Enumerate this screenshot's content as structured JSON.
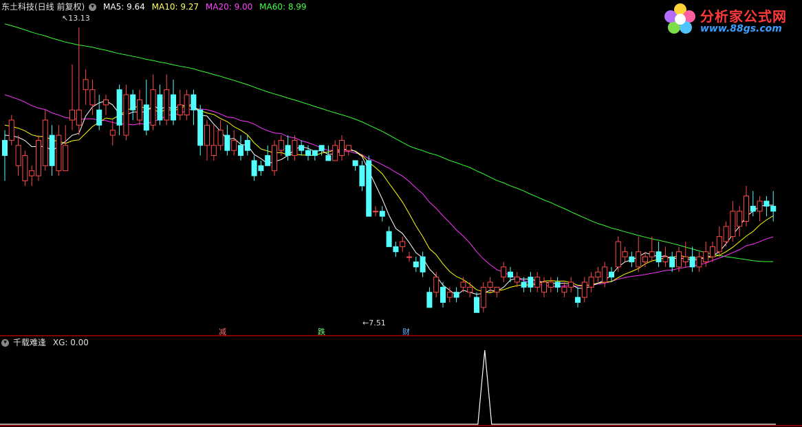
{
  "header": {
    "stock_name": "东土科技(日线 前复权)",
    "ma5": "MA5: 9.64",
    "ma10": "MA10: 9.27",
    "ma20": "MA20: 9.00",
    "ma60": "MA60: 8.99",
    "colors": {
      "ma5": "#ffffff",
      "ma10": "#ffff00",
      "ma20": "#ff33ff",
      "ma60": "#33ff33"
    }
  },
  "logo": {
    "title": "分析家公式网",
    "url": "www.88gs.com"
  },
  "annotations": {
    "high": "13.13",
    "low": "7.51",
    "markers": [
      "减",
      "跌",
      "财"
    ]
  },
  "indicator": {
    "name": "千载难逢",
    "xg": "XG: 0.00"
  },
  "chart_data": {
    "type": "candlestick",
    "ylim": [
      7.3,
      13.4
    ],
    "candles": [
      [
        10.9,
        10.6,
        11.1,
        10.1
      ],
      [
        10.9,
        11.3,
        11.4,
        10.8
      ],
      [
        10.4,
        10.8,
        11.0,
        10.2
      ],
      [
        10.1,
        10.6,
        10.7,
        10.0
      ],
      [
        10.2,
        10.3,
        10.4,
        10.0
      ],
      [
        10.2,
        10.9,
        11.0,
        10.1
      ],
      [
        10.4,
        11.3,
        11.5,
        10.3
      ],
      [
        11.0,
        10.4,
        11.2,
        10.2
      ],
      [
        10.3,
        11.0,
        11.2,
        10.2
      ],
      [
        10.3,
        10.8,
        11.2,
        10.3
      ],
      [
        11.3,
        11.5,
        12.4,
        11.1
      ],
      [
        11.2,
        11.5,
        13.13,
        11.0
      ],
      [
        11.9,
        12.1,
        12.3,
        11.6
      ],
      [
        11.6,
        11.9,
        12.1,
        11.4
      ],
      [
        11.5,
        11.2,
        11.8,
        11.1
      ],
      [
        11.6,
        11.7,
        11.8,
        11.4
      ],
      [
        11.0,
        11.1,
        11.3,
        10.8
      ],
      [
        11.9,
        11.2,
        12.0,
        11.0
      ],
      [
        11.0,
        11.8,
        12.0,
        10.9
      ],
      [
        11.8,
        11.5,
        11.9,
        11.3
      ],
      [
        11.3,
        11.7,
        11.9,
        11.2
      ],
      [
        11.6,
        11.1,
        12.1,
        11.0
      ],
      [
        11.2,
        11.9,
        12.2,
        11.1
      ],
      [
        11.8,
        11.3,
        12.0,
        11.2
      ],
      [
        11.3,
        11.9,
        12.2,
        11.2
      ],
      [
        11.8,
        11.3,
        12.1,
        11.2
      ],
      [
        11.4,
        11.6,
        11.9,
        11.3
      ],
      [
        11.4,
        11.8,
        11.9,
        11.3
      ],
      [
        11.8,
        11.5,
        11.9,
        11.2
      ],
      [
        11.5,
        10.8,
        11.6,
        10.6
      ],
      [
        10.8,
        11.2,
        11.3,
        10.5
      ],
      [
        10.6,
        10.8,
        11.2,
        10.5
      ],
      [
        10.8,
        11.1,
        11.3,
        10.7
      ],
      [
        11.0,
        10.7,
        11.2,
        10.6
      ],
      [
        10.7,
        10.9,
        11.1,
        10.6
      ],
      [
        10.8,
        10.6,
        11.0,
        10.5
      ],
      [
        10.9,
        10.7,
        11.0,
        10.6
      ],
      [
        10.5,
        10.2,
        10.6,
        10.1
      ],
      [
        10.4,
        10.3,
        10.5,
        10.2
      ],
      [
        10.6,
        10.4,
        10.8,
        10.4
      ],
      [
        10.3,
        10.8,
        10.9,
        10.2
      ],
      [
        10.7,
        10.9,
        11.0,
        10.6
      ],
      [
        10.8,
        10.6,
        11.0,
        10.5
      ],
      [
        10.6,
        10.9,
        11.0,
        10.5
      ],
      [
        10.8,
        10.7,
        10.9,
        10.6
      ],
      [
        10.7,
        10.6,
        10.8,
        10.5
      ],
      [
        10.7,
        10.6,
        10.7,
        10.5
      ],
      [
        10.8,
        10.7,
        10.8,
        10.6
      ],
      [
        10.6,
        10.5,
        10.8,
        10.5
      ],
      [
        10.5,
        10.8,
        10.9,
        10.5
      ],
      [
        10.6,
        10.9,
        11.0,
        10.5
      ],
      [
        10.7,
        10.8,
        10.8,
        10.6
      ],
      [
        10.5,
        10.4,
        10.5,
        10.3
      ],
      [
        10.4,
        10.0,
        10.5,
        9.9
      ],
      [
        10.5,
        9.4,
        10.6,
        9.4
      ],
      [
        9.5,
        9.5,
        9.6,
        9.4
      ],
      [
        9.5,
        9.4,
        9.6,
        9.3
      ],
      [
        9.1,
        8.8,
        9.2,
        8.8
      ],
      [
        8.8,
        8.7,
        8.9,
        8.6
      ],
      [
        8.8,
        8.9,
        9.0,
        8.7
      ],
      [
        8.6,
        8.6,
        8.7,
        8.5
      ],
      [
        8.5,
        8.4,
        8.6,
        8.3
      ],
      [
        8.6,
        8.3,
        8.7,
        8.2
      ],
      [
        7.9,
        7.6,
        8.0,
        7.6
      ],
      [
        7.9,
        8.2,
        8.3,
        7.8
      ],
      [
        8.0,
        7.7,
        8.1,
        7.6
      ],
      [
        7.8,
        7.9,
        8.0,
        7.7
      ],
      [
        7.9,
        7.8,
        8.0,
        7.7
      ],
      [
        8.0,
        8.1,
        8.2,
        7.9
      ],
      [
        7.9,
        8.0,
        8.1,
        7.8
      ],
      [
        7.8,
        7.5,
        7.9,
        7.5
      ],
      [
        7.6,
        8.0,
        8.1,
        7.51
      ],
      [
        8.0,
        8.1,
        8.2,
        7.9
      ],
      [
        7.9,
        8.0,
        8.0,
        7.8
      ],
      [
        8.2,
        8.4,
        8.5,
        8.1
      ],
      [
        8.3,
        8.2,
        8.4,
        8.1
      ],
      [
        8.1,
        8.2,
        8.3,
        8.0
      ],
      [
        8.1,
        8.0,
        8.2,
        7.9
      ],
      [
        8.2,
        8.0,
        8.3,
        7.9
      ],
      [
        8.0,
        8.2,
        8.3,
        7.9
      ],
      [
        7.9,
        8.1,
        8.2,
        7.8
      ],
      [
        8.0,
        8.1,
        8.2,
        7.9
      ],
      [
        8.1,
        8.0,
        8.2,
        7.9
      ],
      [
        7.9,
        8.0,
        8.1,
        7.8
      ],
      [
        8.0,
        8.1,
        8.2,
        7.9
      ],
      [
        7.8,
        7.7,
        8.0,
        7.6
      ],
      [
        7.8,
        8.1,
        8.2,
        7.7
      ],
      [
        8.0,
        8.2,
        8.3,
        7.9
      ],
      [
        8.2,
        8.3,
        8.4,
        8.1
      ],
      [
        8.1,
        8.4,
        8.5,
        8.0
      ],
      [
        8.3,
        8.2,
        8.4,
        8.1
      ],
      [
        8.4,
        8.9,
        9.0,
        8.3
      ],
      [
        8.6,
        8.7,
        8.8,
        8.5
      ],
      [
        8.6,
        8.5,
        8.7,
        8.4
      ],
      [
        8.4,
        8.7,
        9.0,
        8.3
      ],
      [
        8.5,
        8.6,
        8.7,
        8.4
      ],
      [
        8.6,
        8.7,
        9.0,
        8.5
      ],
      [
        8.7,
        8.5,
        8.9,
        8.4
      ],
      [
        8.5,
        8.6,
        8.8,
        8.4
      ],
      [
        8.6,
        8.4,
        8.7,
        8.3
      ],
      [
        8.4,
        8.7,
        8.8,
        8.3
      ],
      [
        8.5,
        8.6,
        8.9,
        8.4
      ],
      [
        8.6,
        8.4,
        8.8,
        8.3
      ],
      [
        8.4,
        8.6,
        8.7,
        8.3
      ],
      [
        8.5,
        8.7,
        8.9,
        8.4
      ],
      [
        8.6,
        8.8,
        8.9,
        8.5
      ],
      [
        8.7,
        9.0,
        9.2,
        8.6
      ],
      [
        8.9,
        9.2,
        9.3,
        8.8
      ],
      [
        9.0,
        9.5,
        9.7,
        8.9
      ],
      [
        9.2,
        9.5,
        9.6,
        9.0
      ],
      [
        9.3,
        9.8,
        10.0,
        9.2
      ],
      [
        9.6,
        9.5,
        9.9,
        9.4
      ],
      [
        9.5,
        9.7,
        9.8,
        9.3
      ],
      [
        9.7,
        9.6,
        9.8,
        9.4
      ],
      [
        9.6,
        9.5,
        9.9,
        9.3
      ]
    ]
  },
  "indicator_data": {
    "type": "line",
    "spike_index": 71,
    "values": [
      0,
      1
    ]
  }
}
